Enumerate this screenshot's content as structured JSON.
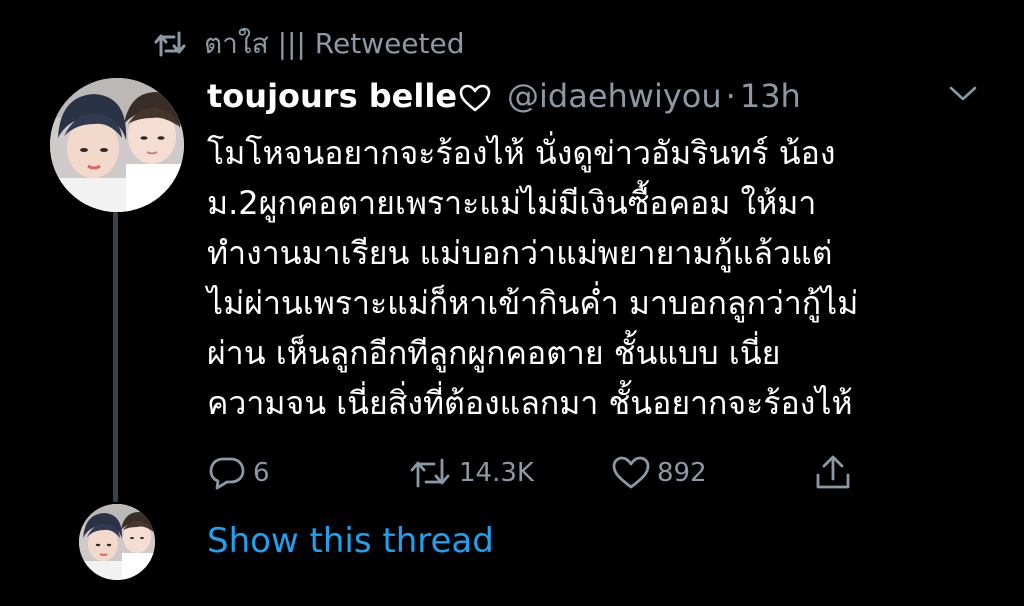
{
  "retweet": {
    "icon": "retweet-icon",
    "label": "ตาใส ||| Retweeted"
  },
  "tweet": {
    "display_name": "toujours belle",
    "name_icon": "heart-outline-icon",
    "handle": "@idaehwiyou",
    "separator": "·",
    "time": "13h",
    "menu_icon": "chevron-down-icon",
    "text_lines": [
      "โมโหจนอยากจะร้องไห้ นั่งดูข่าวอัมรินทร์ น้อง",
      "ม.2ผูกคอตายเพราะแม่ไม่มีเงินซื้อคอม ให้มา",
      "ทำงานมาเรียน แม่บอกว่าแม่พยายามกู้แล้วแต่",
      "ไม่ผ่านเพราะแม่ก็หาเข้ากินค่ำ มาบอกลูกว่ากู้ไม่",
      "ผ่าน เห็นลูกอีกทีลูกผูกคอตาย ชั้นแบบ เนี่ย",
      "ความจน เนี่ยสิ่งที่ต้องแลกมา ชั้นอยากจะร้องไห้"
    ],
    "actions": {
      "reply": {
        "icon": "reply-icon",
        "count": "6"
      },
      "retweet": {
        "icon": "retweet-icon",
        "count": "14.3K"
      },
      "like": {
        "icon": "heart-icon",
        "count": "892"
      },
      "share": {
        "icon": "share-icon"
      }
    }
  },
  "thread": {
    "link_label": "Show this thread"
  },
  "colors": {
    "background": "#000000",
    "primary_text": "#ffffff",
    "secondary_text": "#8b98a5",
    "link": "#1da1f2",
    "thread_line": "#38444d"
  }
}
